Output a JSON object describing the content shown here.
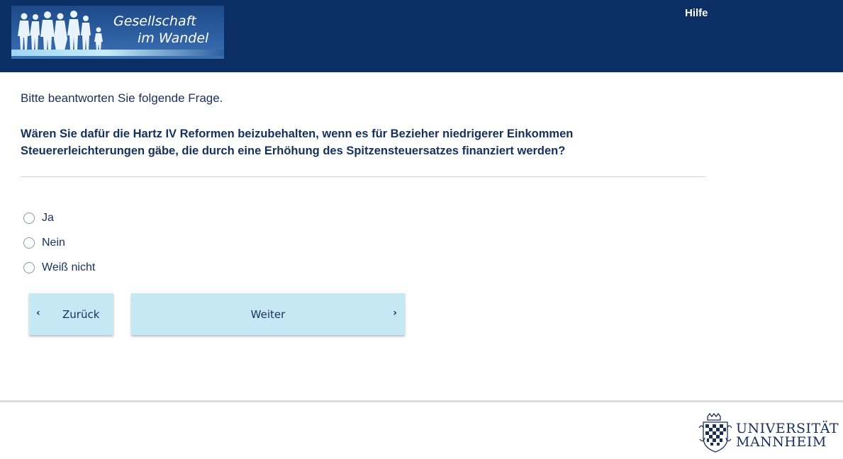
{
  "header": {
    "logo": {
      "line1": "Gesellschaft",
      "line2": "im Wandel",
      "icon": "silhouettes-icon"
    },
    "help_label": "Hilfe",
    "colors": {
      "background": "#0b2f64"
    }
  },
  "survey": {
    "instruction": "Bitte beantworten Sie folgende Frage.",
    "question_line1": "Wären Sie dafür die Hartz IV Reformen beizubehalten, wenn es für Bezieher niedrigerer Einkommen",
    "question_line2": "Steuererleichterungen gäbe, die durch eine Erhöhung des Spitzensteuersatzes finanziert werden?",
    "options": [
      {
        "label": "Ja",
        "selected": false
      },
      {
        "label": "Nein",
        "selected": false
      },
      {
        "label": "Weiß nicht",
        "selected": false
      }
    ]
  },
  "navigation": {
    "back_label": "Zurück",
    "next_label": "Weiter",
    "back_icon": "chevron-left-icon",
    "next_icon": "chevron-right-icon",
    "button_color": "#c6e8f5"
  },
  "footer": {
    "university_line1": "UNIVERSITÄT",
    "university_line2": "MANNHEIM",
    "crest_icon": "university-crest-icon"
  }
}
